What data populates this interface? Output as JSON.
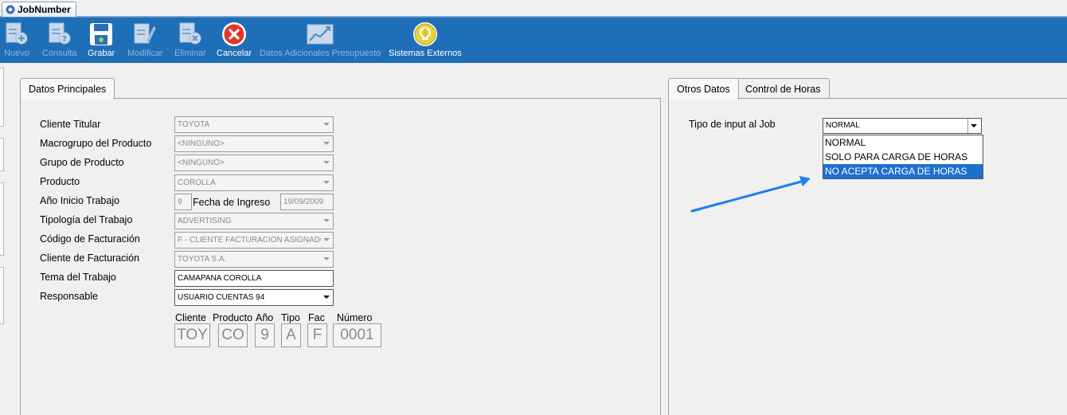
{
  "window": {
    "tab_title": "JobNumber"
  },
  "toolbar": {
    "buttons": [
      {
        "label": "Nuevo",
        "enabled": false,
        "icon": "new-doc-icon"
      },
      {
        "label": "Consulta",
        "enabled": false,
        "icon": "query-doc-icon"
      },
      {
        "label": "Grabar",
        "enabled": true,
        "icon": "save-icon"
      },
      {
        "label": "Modificar",
        "enabled": false,
        "icon": "edit-icon"
      },
      {
        "label": "Eliminar",
        "enabled": false,
        "icon": "delete-doc-icon"
      },
      {
        "label": "Cancelar",
        "enabled": true,
        "icon": "cancel-icon"
      },
      {
        "label": "Datos Adicionales Presupuesto",
        "enabled": false,
        "icon": "chart-icon"
      },
      {
        "label": "Sistemas Externos",
        "enabled": true,
        "icon": "external-systems-icon"
      }
    ]
  },
  "left_panel": {
    "tab": "Datos Principales",
    "fields": {
      "cliente_titular": {
        "label": "Cliente Titular",
        "value": "TOYOTA"
      },
      "macrogrupo": {
        "label": "Macrogrupo del Producto",
        "value": "<NINGUNO>"
      },
      "grupo": {
        "label": "Grupo de Producto",
        "value": "<NINGUNO>"
      },
      "producto": {
        "label": "Producto",
        "value": "COROLLA"
      },
      "anio_inicio": {
        "label": "Año Inicio Trabajo",
        "value": "9"
      },
      "fecha_ingreso": {
        "label": "Fecha de Ingreso",
        "value": "19/09/2009"
      },
      "tipologia": {
        "label": "Tipología del Trabajo",
        "value": "ADVERTISING"
      },
      "codigo_facturacion": {
        "label": "Código de Facturación",
        "value": "F - CLIENTE FACTURACIÓN ASIGNADO"
      },
      "cliente_facturacion": {
        "label": "Cliente de Facturación",
        "value": "TOYOTA S.A."
      },
      "tema": {
        "label": "Tema del Trabajo",
        "value": "CAMAPANA COROLLA"
      },
      "responsable": {
        "label": "Responsable",
        "value": "USUARIO CUENTAS 94"
      }
    },
    "job_code": {
      "cliente": {
        "label": "Cliente",
        "value": "TOY"
      },
      "producto": {
        "label": "Producto",
        "value": "CO"
      },
      "anio": {
        "label": "Año",
        "value": "9"
      },
      "tipo": {
        "label": "Tipo",
        "value": "A"
      },
      "fac": {
        "label": "Fac",
        "value": "F"
      },
      "numero": {
        "label": "Número",
        "value": "0001"
      }
    }
  },
  "right_panel": {
    "tabs": [
      "Otros Datos",
      "Control de Horas"
    ],
    "active_tab": "Otros Datos",
    "tipo_input": {
      "label": "Tipo de input al Job",
      "value": "NORMAL",
      "options": [
        "NORMAL",
        "SOLO PARA CARGA DE HORAS",
        "NO ACEPTA CARGA DE HORAS"
      ],
      "highlighted": "NO ACEPTA CARGA DE HORAS"
    }
  },
  "colors": {
    "toolbar_bg": "#1f6fb8",
    "selection": "#1f6fd0",
    "annotation_arrow": "#1e7ff0"
  }
}
